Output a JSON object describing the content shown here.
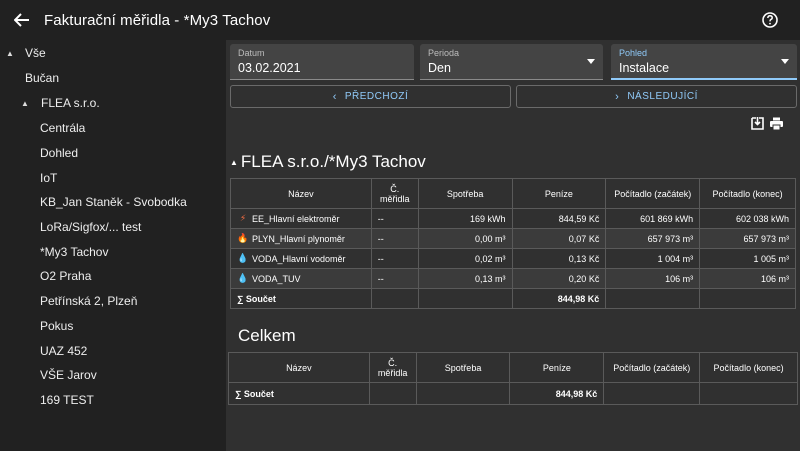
{
  "appbar": {
    "title": "Fakturační měřidla - *My3 Tachov",
    "back_icon": "arrow-left-icon",
    "help_icon": "help-circle-icon"
  },
  "sidebar": {
    "items": [
      {
        "label": "Vše",
        "expanded": true
      },
      {
        "label": "Bučan"
      },
      {
        "label": "FLEA s.r.o.",
        "expanded": true
      },
      {
        "label": "Centrála"
      },
      {
        "label": "Dohled"
      },
      {
        "label": "IoT"
      },
      {
        "label": "KB_Jan Staněk - Svobodka"
      },
      {
        "label": "LoRa/Sigfox/... test"
      },
      {
        "label": "*My3 Tachov"
      },
      {
        "label": "O2 Praha"
      },
      {
        "label": "Petřínská 2, Plzeň"
      },
      {
        "label": "Pokus"
      },
      {
        "label": "UAZ 452"
      },
      {
        "label": "VŠE Jarov"
      },
      {
        "label": "169 TEST"
      }
    ]
  },
  "filters": {
    "date": {
      "label": "Datum",
      "value": "03.02.2021"
    },
    "period": {
      "label": "Perioda",
      "value": "Den"
    },
    "view": {
      "label": "Pohled",
      "value": "Instalace"
    }
  },
  "nav": {
    "prev": "PŘEDCHOZÍ",
    "next": "NÁSLEDUJÍCÍ"
  },
  "tools": {
    "export_icon": "export-icon",
    "print_icon": "print-icon"
  },
  "columns": [
    "Název",
    "Č. měřidla",
    "Spotřeba",
    "Peníze",
    "Počítadlo (začátek)",
    "Počítadlo (konec)"
  ],
  "section1": {
    "title": "FLEA s.r.o./*My3 Tachov",
    "rows": [
      {
        "icon": "⚡",
        "icon_color": "#ff7043",
        "name": "EE_Hlavní elektroměr",
        "number": "--",
        "consumption": "169 kWh",
        "money": "844,59 Kč",
        "start": "601 869 kWh",
        "end": "602 038 kWh"
      },
      {
        "icon": "🔥",
        "icon_color": "#ffa726",
        "name": "PLYN_Hlavní plynoměr",
        "number": "--",
        "consumption": "0,00 m³",
        "money": "0,07 Kč",
        "start": "657 973 m³",
        "end": "657 973 m³"
      },
      {
        "icon": "💧",
        "icon_color": "#4fc3f7",
        "name": "VODA_Hlavní vodoměr",
        "number": "--",
        "consumption": "0,02 m³",
        "money": "0,13 Kč",
        "start": "1 004 m³",
        "end": "1 005 m³"
      },
      {
        "icon": "💧",
        "icon_color": "#4fc3f7",
        "name": "VODA_TUV",
        "number": "--",
        "consumption": "0,13 m³",
        "money": "0,20 Kč",
        "start": "106 m³",
        "end": "106 m³"
      }
    ],
    "total_label": "∑ Součet",
    "total_money": "844,98 Kč"
  },
  "section2": {
    "title": "Celkem",
    "total_label": "∑ Součet",
    "total_money": "844,98 Kč"
  }
}
